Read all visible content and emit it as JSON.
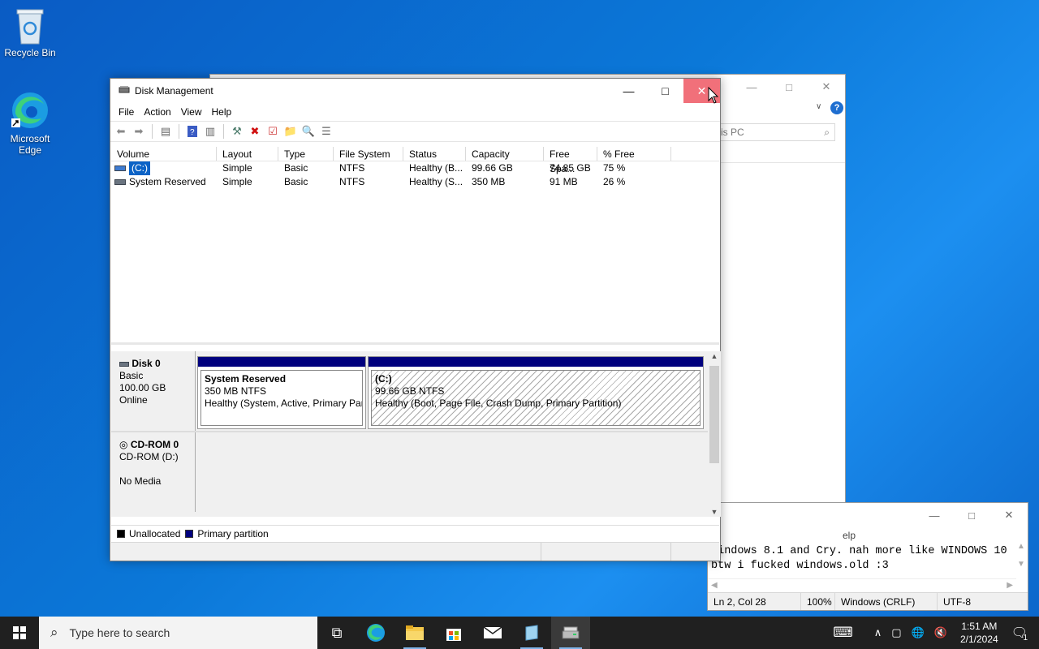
{
  "desktop": {
    "icons": [
      {
        "label": "Recycle Bin",
        "icon": "recycle-bin-icon"
      },
      {
        "label": "Microsoft Edge",
        "icon": "edge-icon"
      }
    ]
  },
  "explorer": {
    "search_placeholder": "is PC"
  },
  "notepad": {
    "menu_fragment": "elp",
    "text_lines": [
      "windows 8.1 and Cry. nah more like WINDOWS 10",
      "btw i fucked windows.old :3"
    ],
    "status": [
      "Ln 2, Col 28",
      "100%",
      "Windows (CRLF)",
      "UTF-8"
    ]
  },
  "disk_management": {
    "title": "Disk Management",
    "menu": [
      "File",
      "Action",
      "View",
      "Help"
    ],
    "columns": [
      "Volume",
      "Layout",
      "Type",
      "File System",
      "Status",
      "Capacity",
      "Free Spa...",
      "% Free"
    ],
    "volumes": [
      {
        "name": "(C:)",
        "layout": "Simple",
        "type": "Basic",
        "fs": "NTFS",
        "status": "Healthy (B...",
        "capacity": "99.66 GB",
        "free": "74.85 GB",
        "pct": "75 %"
      },
      {
        "name": "System Reserved",
        "layout": "Simple",
        "type": "Basic",
        "fs": "NTFS",
        "status": "Healthy (S...",
        "capacity": "350 MB",
        "free": "91 MB",
        "pct": "26 %"
      }
    ],
    "disks": [
      {
        "name": "Disk 0",
        "type": "Basic",
        "size": "100.00 GB",
        "state": "Online"
      },
      {
        "name": "CD-ROM 0",
        "type": "CD-ROM (D:)",
        "size": "",
        "state": "No Media"
      }
    ],
    "partitions": [
      {
        "name": "System Reserved",
        "size": "350 MB NTFS",
        "status": "Healthy (System, Active, Primary Partition)"
      },
      {
        "name": "(C:)",
        "size": "99.66 GB NTFS",
        "status": "Healthy (Boot, Page File, Crash Dump, Primary Partition)"
      }
    ],
    "legend": [
      "Unallocated",
      "Primary partition"
    ],
    "colors": {
      "unallocated": "#000000",
      "primary": "#00007e",
      "close_hover": "#f1707a"
    }
  },
  "taskbar": {
    "search_placeholder": "Type here to search",
    "time": "1:51 AM",
    "date": "2/1/2024",
    "notification_count": "1"
  }
}
